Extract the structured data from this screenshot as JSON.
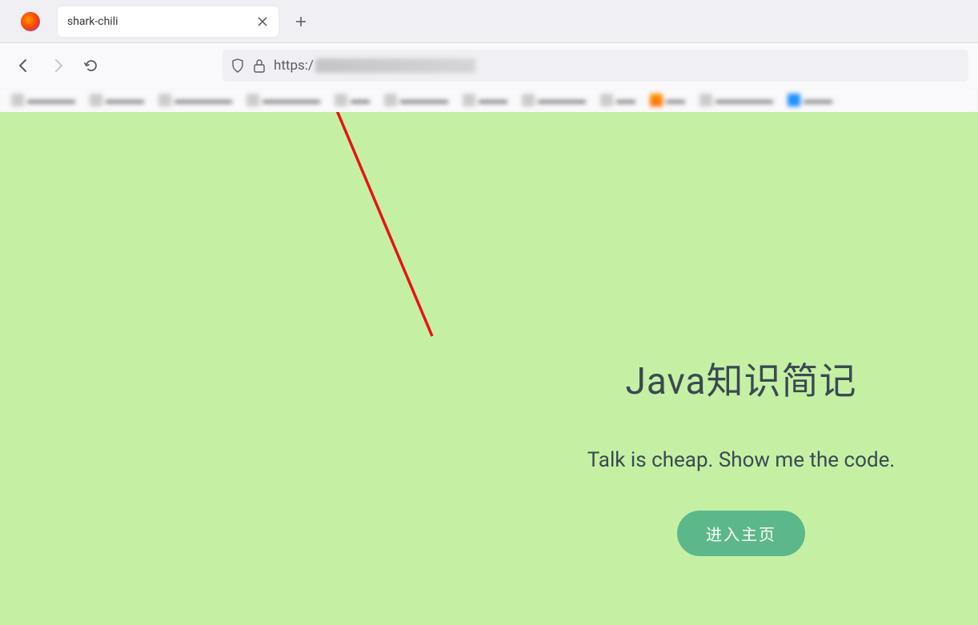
{
  "browser": {
    "tab_title": "shark-chili",
    "url_prefix": "https:/"
  },
  "hero": {
    "title": "Java知识简记",
    "subtitle": "Talk is cheap. Show me the code.",
    "button": "进入主页"
  },
  "annotation": {
    "arrow_color": "#e81313"
  }
}
